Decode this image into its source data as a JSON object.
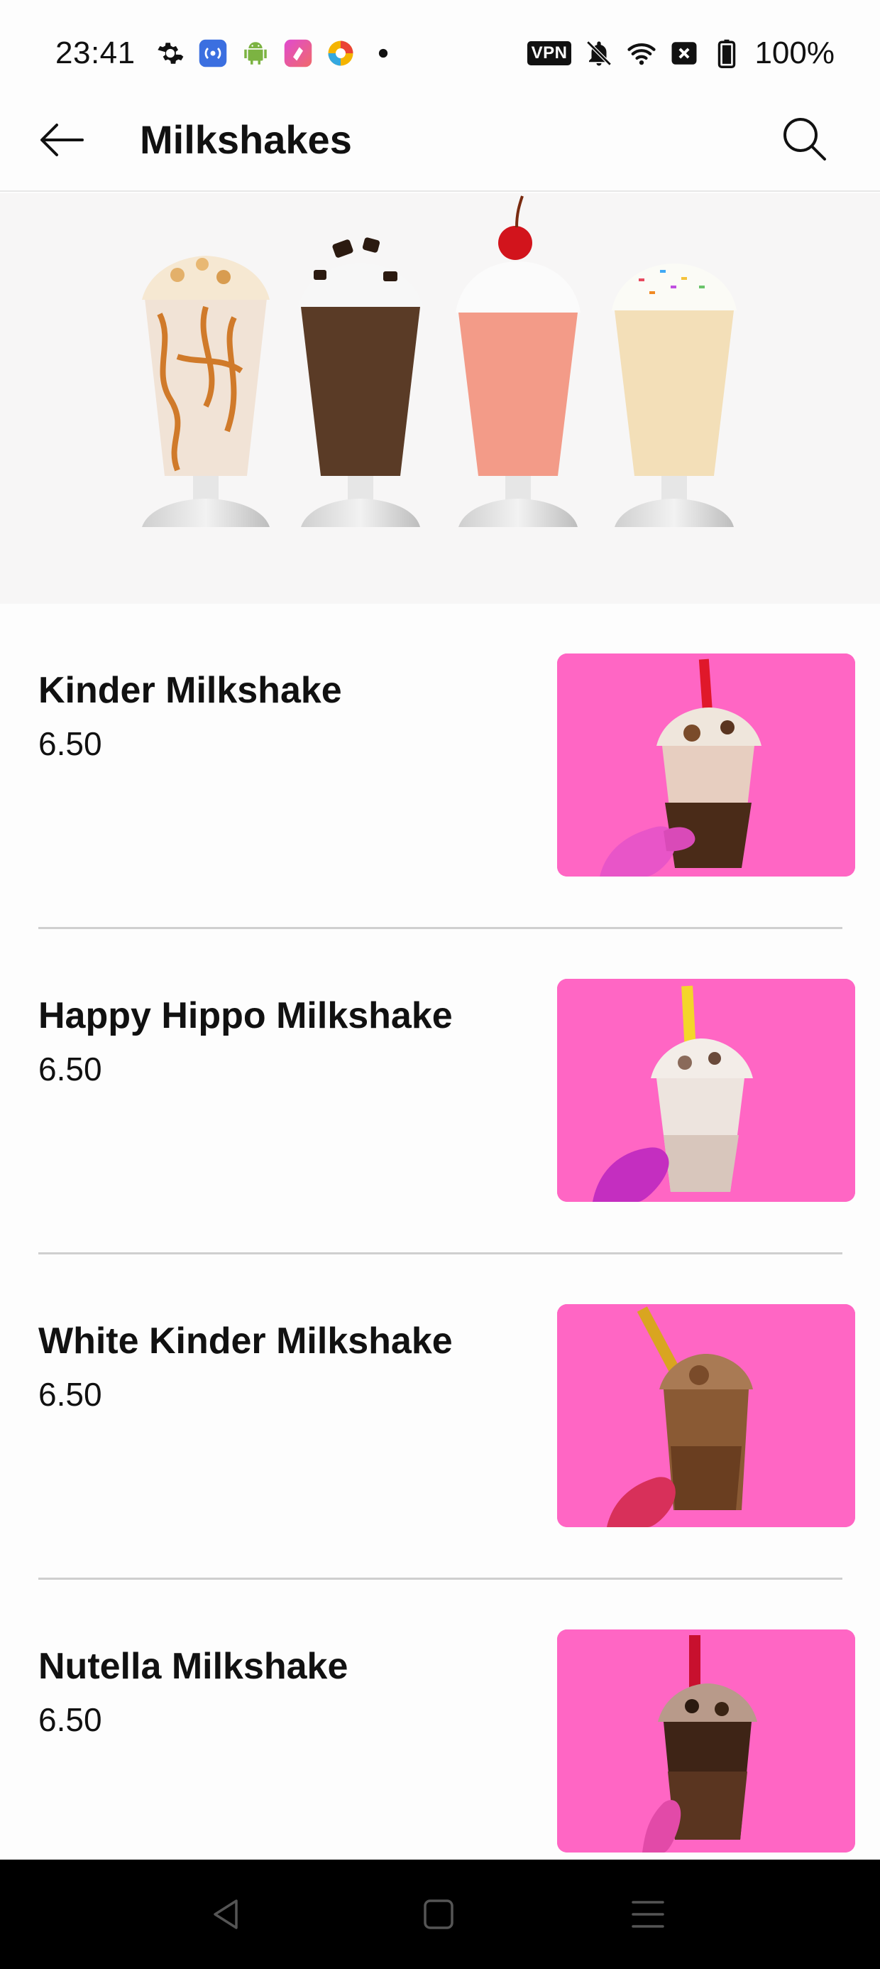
{
  "status_bar": {
    "time": "23:41",
    "left_icons": [
      "gear-icon",
      "broadcast-icon",
      "android-icon",
      "shortcut-app-icon",
      "colorful-app-icon",
      "dot-icon"
    ],
    "vpn_label": "VPN",
    "right_icons": [
      "bell-off-icon",
      "wifi-icon",
      "no-sim-icon",
      "battery-icon"
    ],
    "battery": "100%"
  },
  "app_bar": {
    "title": "Milkshakes",
    "back_icon": "arrow-left-icon",
    "search_icon": "search-icon"
  },
  "hero": {
    "image": "milkshake-glasses-banner"
  },
  "products": [
    {
      "name": "Kinder Milkshake",
      "price": "6.50"
    },
    {
      "name": "Happy Hippo Milkshake",
      "price": "6.50"
    },
    {
      "name": "White Kinder Milkshake",
      "price": "6.50"
    },
    {
      "name": "Nutella Milkshake",
      "price": "6.50"
    }
  ],
  "colors": {
    "product_image_bg": "#ff66c4",
    "divider": "#cfcfcf",
    "nav_bar": "#000000"
  },
  "nav_bar": {
    "buttons": [
      "back-triangle-icon",
      "home-square-icon",
      "menu-lines-icon"
    ]
  }
}
